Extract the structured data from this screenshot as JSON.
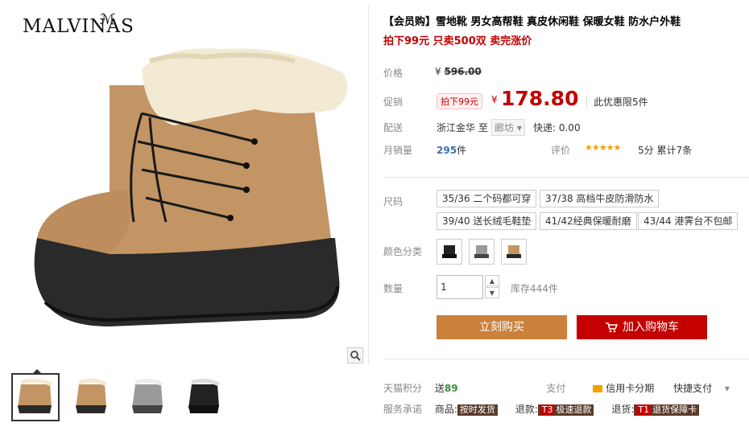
{
  "brand": {
    "name": "MALVINAS"
  },
  "product": {
    "title": "【会员购】雪地靴 男女高帮鞋 真皮休闲鞋 保暖女鞋 防水户外鞋",
    "subtitle": "拍下99元 只卖500双 卖完涨价"
  },
  "price": {
    "label": "价格",
    "currency": "¥",
    "original": "596.00",
    "promo_label": "促销",
    "promo_tag": "拍下99元",
    "promo_currency": "¥",
    "promo_value": "178.80",
    "promo_limit": "此优惠限5件"
  },
  "shipping": {
    "label": "配送",
    "from": "浙江金华",
    "to_word": "至",
    "to": "廊坊",
    "fee": "快递: 0.00"
  },
  "sales": {
    "label": "月销量",
    "count": "295",
    "unit": "件",
    "rating_label": "评价",
    "stars": "★★★★★",
    "score": "5分",
    "reviews": "累计7条"
  },
  "size": {
    "label": "尺码",
    "options": [
      "35/36 二个码都可穿",
      "37/38 高档牛皮防滑防水",
      "39/40 送长绒毛鞋垫",
      "41/42经典保暖耐磨",
      "43/44 港霁台不包邮"
    ]
  },
  "color": {
    "label": "颜色分类"
  },
  "quantity": {
    "label": "数量",
    "value": "1",
    "stock": "库存444件"
  },
  "buttons": {
    "buy_now": "立刻购买",
    "add_cart": "加入购物车"
  },
  "footer": {
    "points_label": "天猫积分",
    "points_prefix": "送",
    "points": "89",
    "pay_label": "支付",
    "credit": "信用卡分期",
    "fast_pay": "快捷支付",
    "service_label": "服务承诺",
    "svc_goods": "商品:",
    "svc_goods_badge": "按时发货",
    "svc_refund": "退款:",
    "svc_refund_k": "T3",
    "svc_refund_badge": "极速退款",
    "svc_return": "退货:",
    "svc_return_k": "T1",
    "svc_return_badge": "退货保障卡"
  },
  "colors": {
    "promo_red": "#c40000",
    "buy_orange": "#c9813c",
    "star_gold": "#f4a000"
  }
}
